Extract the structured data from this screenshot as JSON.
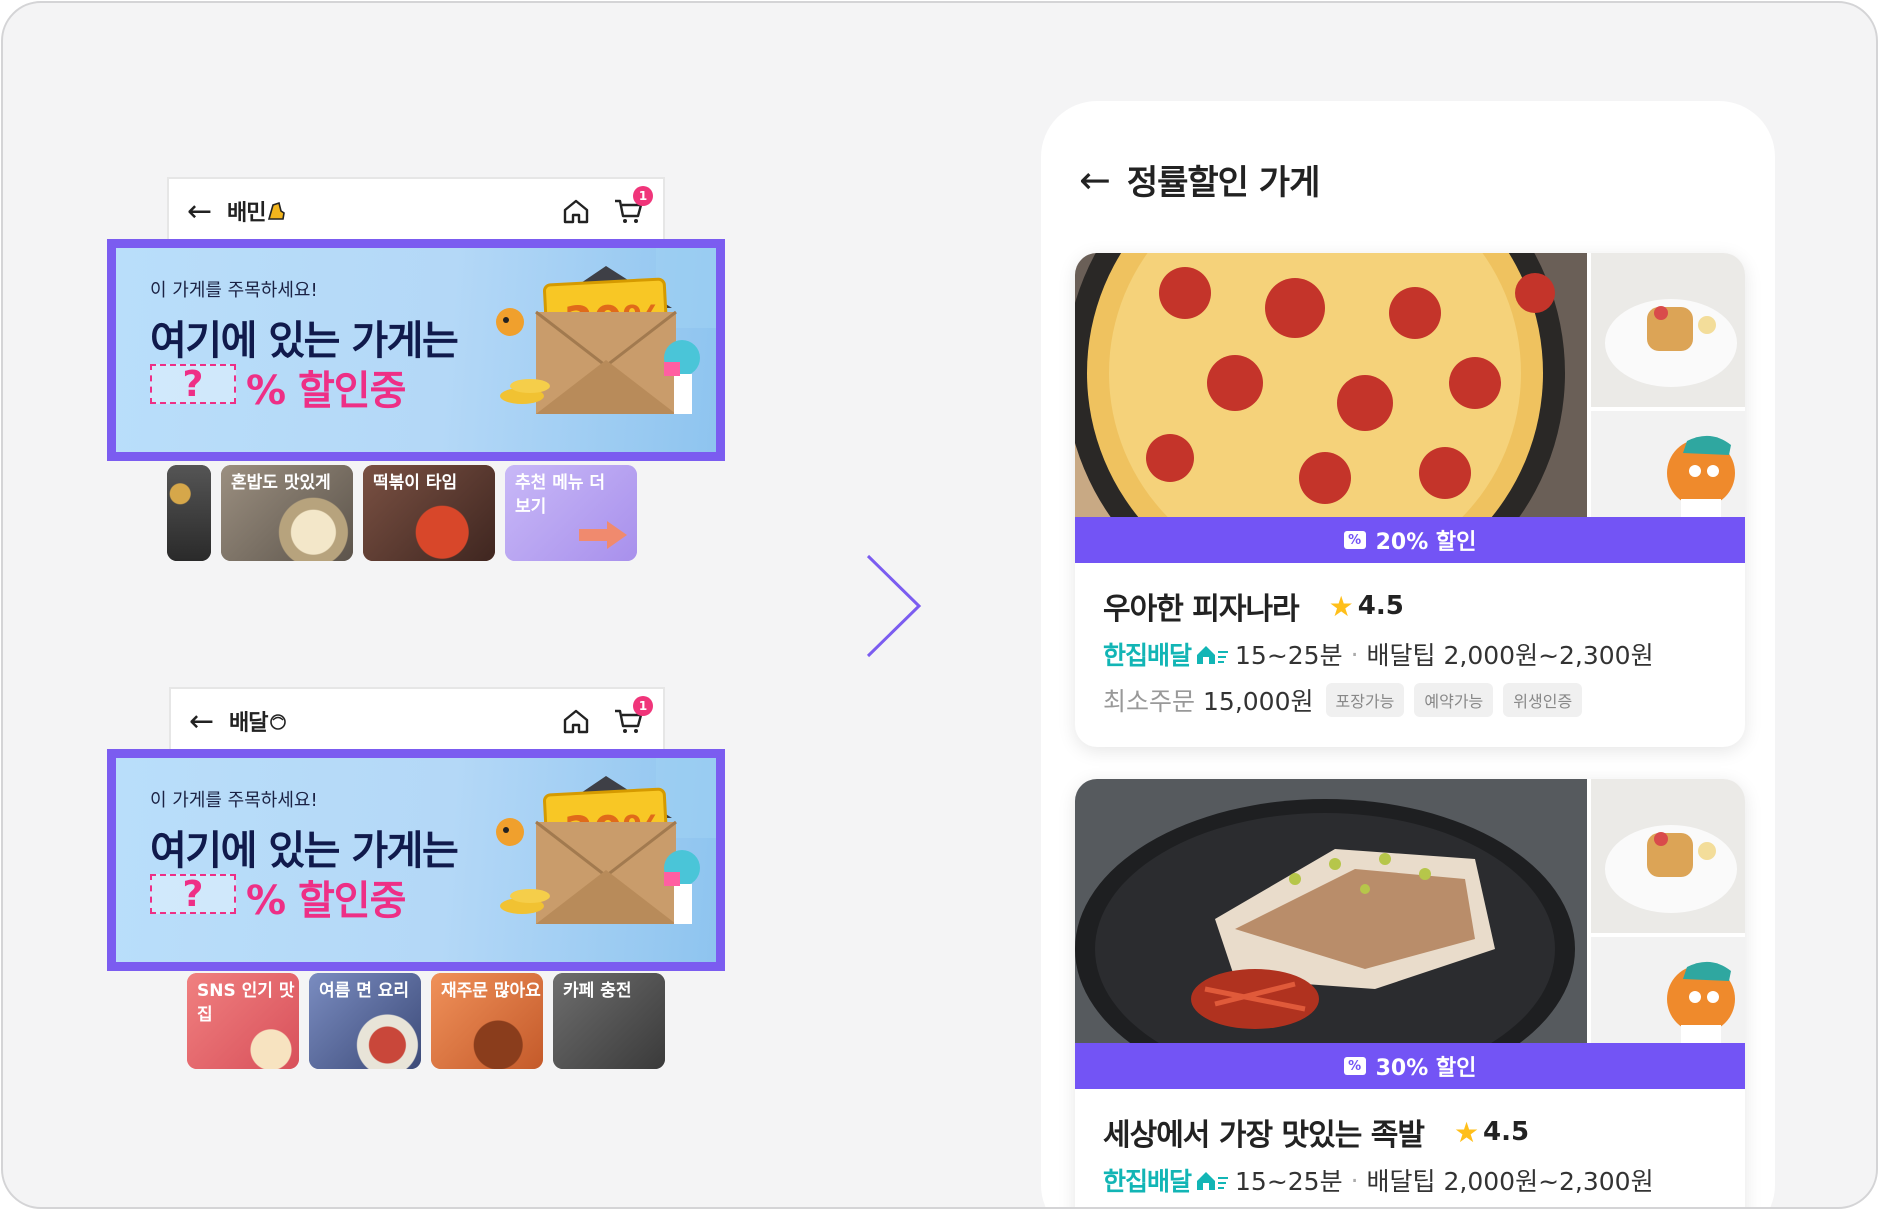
{
  "colors": {
    "accent": "#7b5cf0",
    "discount_bar": "#7354f5",
    "pink": "#ee2f86",
    "teal": "#12b5b5",
    "star": "#ffbf1a"
  },
  "screen1": {
    "brand": "배민",
    "cart_count": "1",
    "banner": {
      "kicker": "이 가게를 주목하세요!",
      "headline": "여기에 있는 가게는",
      "question": "?",
      "percent_text": "% 할인중",
      "coupon": "20%"
    },
    "chips": [
      {
        "label": ""
      },
      {
        "label": "혼밥도 맛있게"
      },
      {
        "label": "떡볶이 타임"
      },
      {
        "label": "추천 메뉴 더 보기"
      }
    ]
  },
  "screen2": {
    "brand": "배달",
    "cart_count": "1",
    "banner": {
      "kicker": "이 가게를 주목하세요!",
      "headline": "여기에 있는 가게는",
      "question": "?",
      "percent_text": "% 할인중",
      "coupon": "20%"
    },
    "chips": [
      {
        "label": "SNS 인기 맛집"
      },
      {
        "label": "여름 면 요리"
      },
      {
        "label": "재주문 많아요"
      },
      {
        "label": "카페 충전"
      }
    ]
  },
  "detail": {
    "title": "정률할인 가게",
    "stores": [
      {
        "discount": "20% 할인",
        "name": "우아한 피자나라",
        "rating": "4.5",
        "delivery_type": "한집배달",
        "time": "15~25분",
        "tip": "배달팁 2,000원~2,300원",
        "min_label": "최소주문",
        "min_value": "15,000원",
        "tags": [
          "포장가능",
          "예약가능",
          "위생인증"
        ]
      },
      {
        "discount": "30% 할인",
        "name": "세상에서 가장 맛있는 족발",
        "rating": "4.5",
        "delivery_type": "한집배달",
        "time": "15~25분",
        "tip": "배달팁 2,000원~2,300원"
      }
    ]
  }
}
